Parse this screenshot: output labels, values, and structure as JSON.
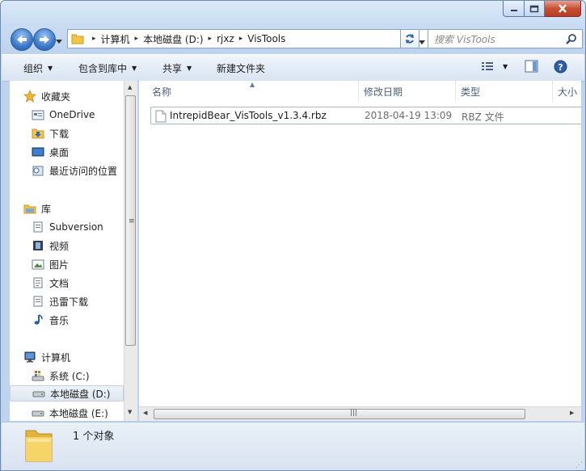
{
  "window": {
    "buttons": {
      "minimize": "minimize",
      "maximize": "maximize",
      "close": "close"
    }
  },
  "address": {
    "crumbs": [
      "计算机",
      "本地磁盘 (D:)",
      "rjxz",
      "VisTools"
    ]
  },
  "search": {
    "placeholder": "搜索 VisTools"
  },
  "toolbar": {
    "organize": "组织",
    "include_in_library": "包含到库中",
    "share": "共享",
    "new_folder": "新建文件夹"
  },
  "navpane": {
    "favorites": {
      "label": "收藏夹",
      "items": [
        {
          "label": "OneDrive"
        },
        {
          "label": "下载"
        },
        {
          "label": "桌面"
        },
        {
          "label": "最近访问的位置"
        }
      ]
    },
    "libraries": {
      "label": "库",
      "items": [
        {
          "label": "Subversion"
        },
        {
          "label": "视频"
        },
        {
          "label": "图片"
        },
        {
          "label": "文档"
        },
        {
          "label": "迅雷下载"
        },
        {
          "label": "音乐"
        }
      ]
    },
    "computer": {
      "label": "计算机",
      "items": [
        {
          "label": "系统 (C:)"
        },
        {
          "label": "本地磁盘 (D:)",
          "selected": true
        },
        {
          "label": "本地磁盘 (E:)"
        }
      ]
    }
  },
  "list": {
    "columns": [
      "名称",
      "修改日期",
      "类型",
      "大小"
    ],
    "files": [
      {
        "name": "IntrepidBear_VisTools_v1.3.4.rbz",
        "modified": "2018-04-19 13:09",
        "type": "RBZ 文件",
        "size": ""
      }
    ]
  },
  "status": {
    "count_text": "1 个对象"
  },
  "colors": {
    "accent": "#3b78c9",
    "folder": "#f4c542",
    "window_frame": "#bdd3ee"
  }
}
